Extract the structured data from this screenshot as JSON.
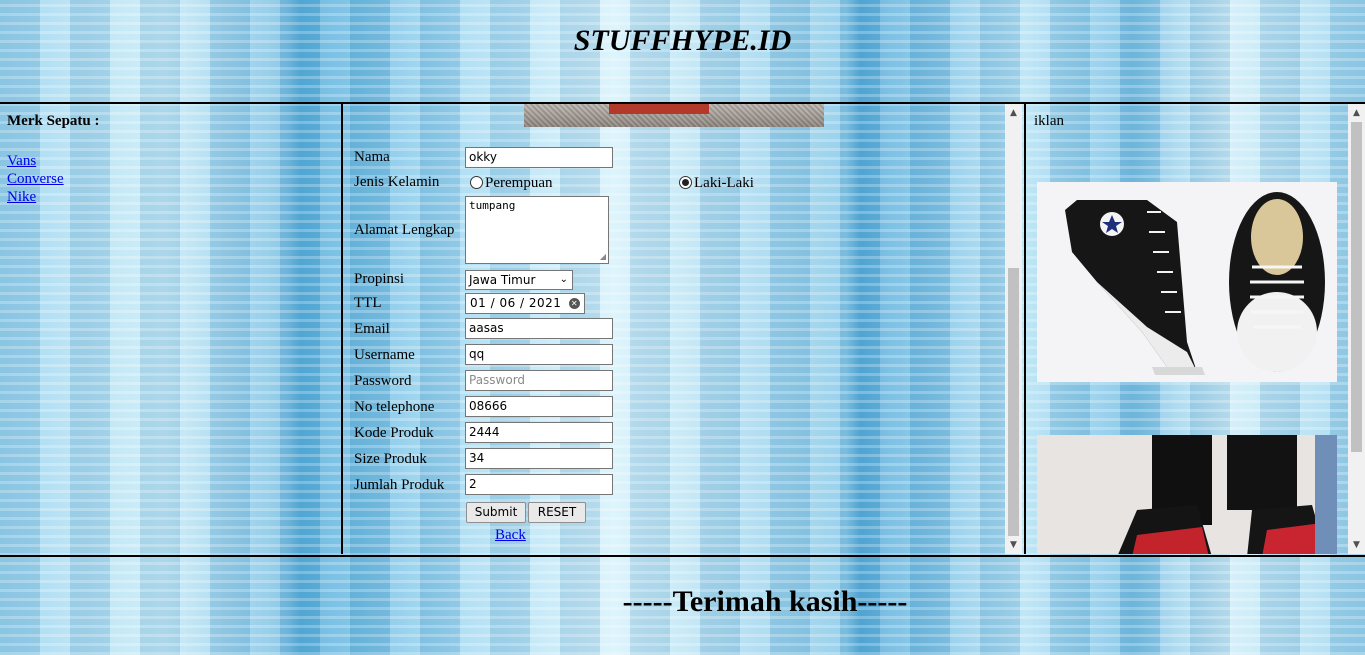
{
  "header": {
    "title": "STUFFHYPE.ID"
  },
  "left": {
    "title": "Merk Sepatu :",
    "brands": [
      "Vans",
      "Converse",
      "Nike"
    ]
  },
  "form": {
    "nama_label": "Nama",
    "nama_value": "okky",
    "gender_label": "Jenis Kelamin",
    "gender_opt1": "Perempuan",
    "gender_opt2": "Laki-Laki",
    "gender_selected": "Laki-Laki",
    "alamat_label": "Alamat Lengkap",
    "alamat_value": "tumpang",
    "propinsi_label": "Propinsi",
    "propinsi_value": "Jawa Timur",
    "ttl_label": "TTL",
    "ttl_value": "01 / 06 / 2021",
    "email_label": "Email",
    "email_value": "aasas",
    "username_label": "Username",
    "username_value": "qq",
    "password_label": "Password",
    "password_placeholder": "Password",
    "telp_label": "No telephone",
    "telp_value": "08666",
    "kode_label": "Kode Produk",
    "kode_value": "2444",
    "size_label": "Size Produk",
    "size_value": "34",
    "jumlah_label": "Jumlah Produk",
    "jumlah_value": "2",
    "submit_label": "Submit",
    "reset_label": "RESET",
    "back_label": "Back"
  },
  "right": {
    "title": "iklan"
  },
  "footer": {
    "text": "-----Terimah kasih-----"
  }
}
